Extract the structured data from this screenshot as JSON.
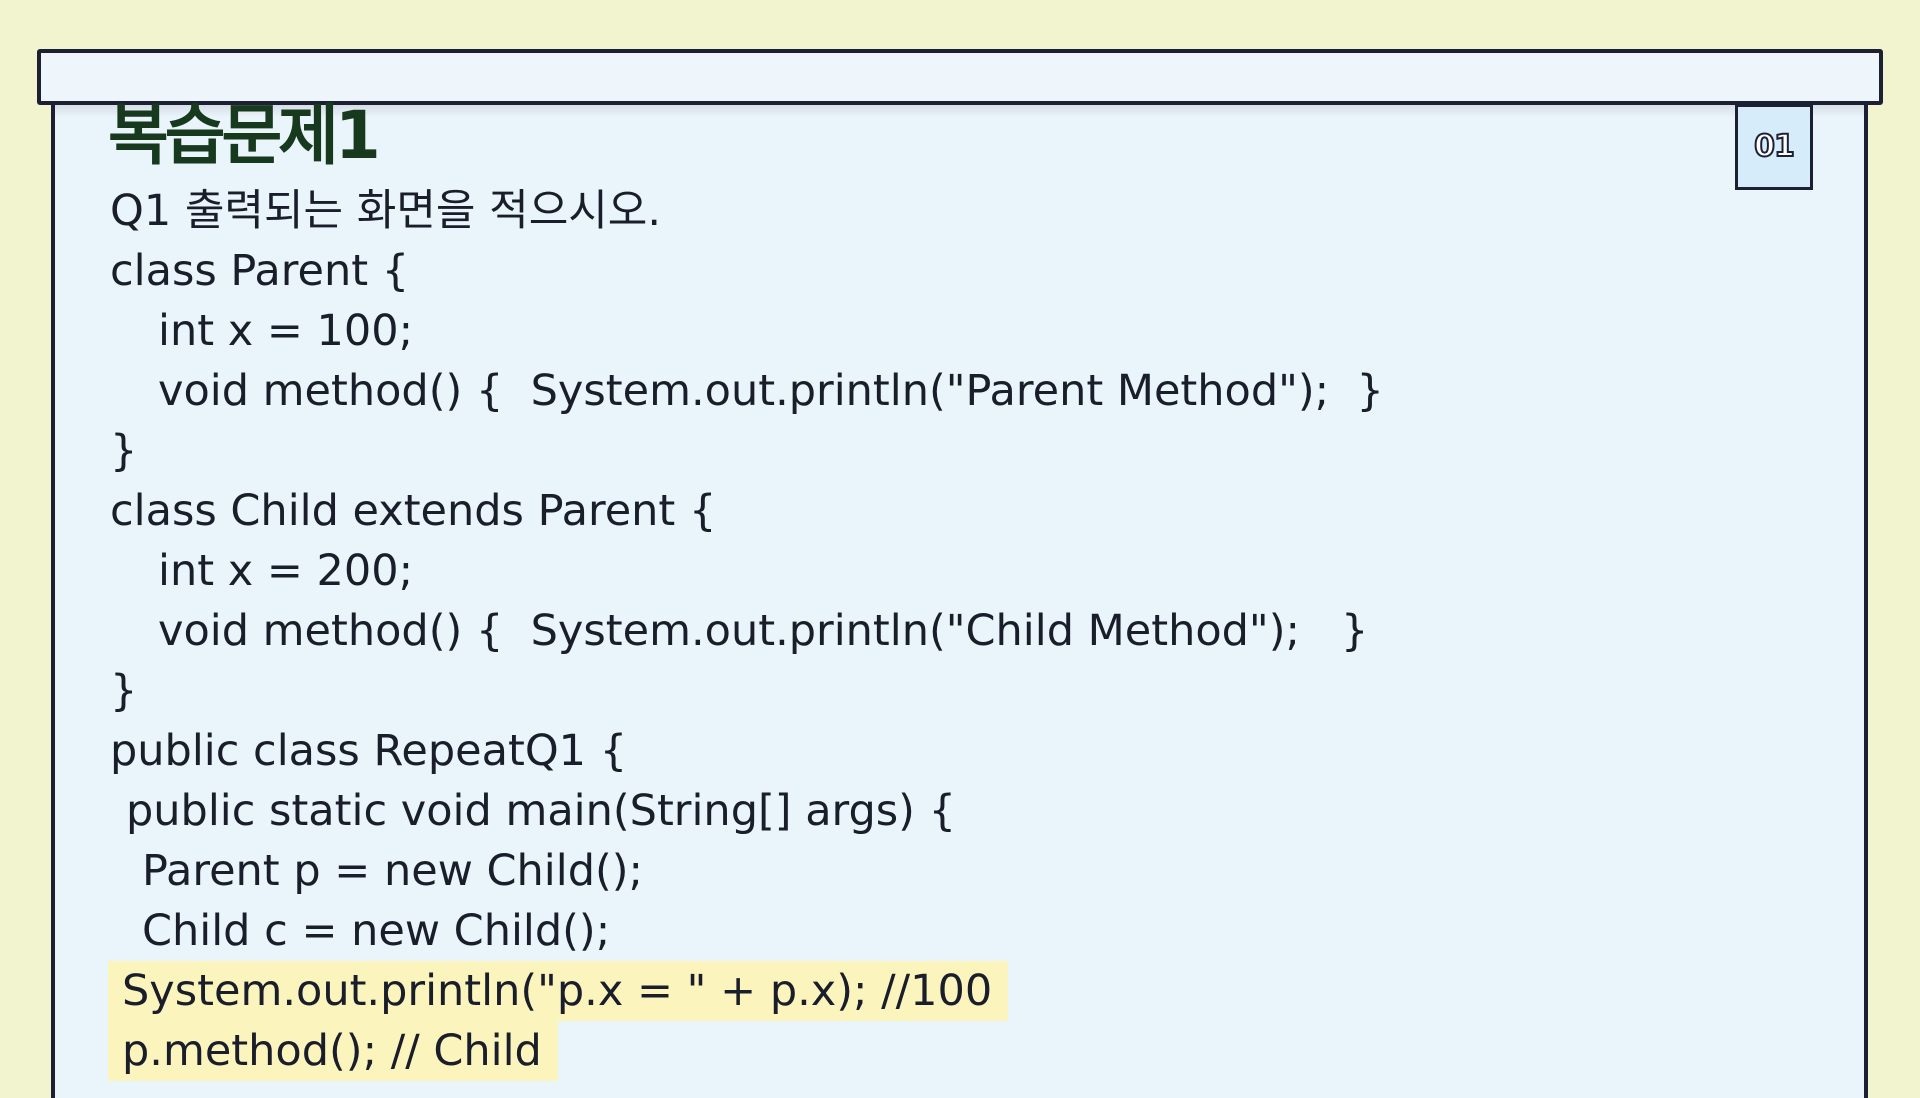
{
  "title": "복습문제1",
  "badge": "01",
  "question": "Q1 출력되는 화면을 적으시오.",
  "code_lines": [
    "class Parent {",
    "int x = 100;",
    "void method() {  System.out.println(\"Parent Method\");  }",
    "}",
    "class Child extends Parent {",
    "int x = 200;",
    "void method() {  System.out.println(\"Child Method\");   }",
    "}",
    "public class RepeatQ1 {",
    "public static void main(String[] args) {",
    "Parent p = new Child();",
    "Child c = new Child();",
    "System.out.println(\"p.x = \" + p.x); //100",
    "p.method(); // Child"
  ]
}
